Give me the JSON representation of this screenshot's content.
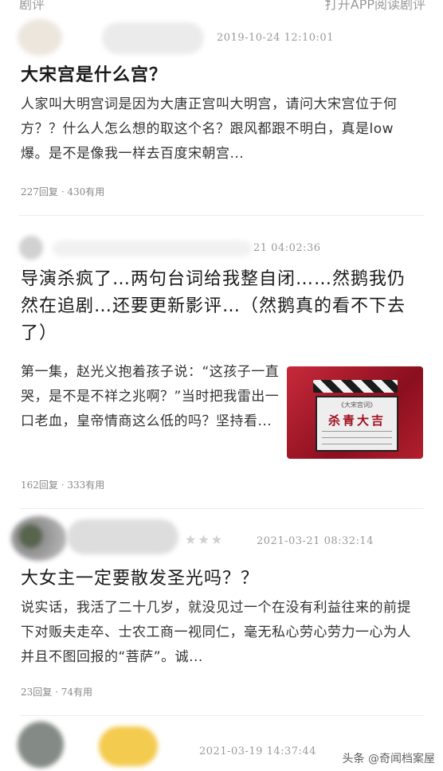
{
  "topbar": {
    "left_text": "剧评",
    "right_text": "打开APP阅读剧评"
  },
  "reviews": [
    {
      "date": "2019-10-24 12:10:01",
      "title": "大宋宫是什么宫？",
      "body": "人家叫大明宫词是因为大唐正宫叫大明宫，请问大宋宫位于何方？？什么人怎么想的取这个名？跟风都跟不明白，真是low爆。是不是像我一样去百度宋朝宫...",
      "stats": "227回复 · 430有用"
    },
    {
      "date": "21 04:02:36",
      "title": "导演杀疯了…两句台词给我整自闭……然鹅我仍然在追剧…还要更新影评…（然鹅真的看不下去了）",
      "body": "第一集，赵光义抱着孩子说：“这孩子一直哭，是不是不祥之兆啊？”当时把我雷出一口老血，皇帝情商这么低的吗？坚持看...",
      "stats": "162回复 · 333有用",
      "thumb_text": "杀青大吉",
      "thumb_sub": "《大宋宫词》"
    },
    {
      "date": "2021-03-21 08:32:14",
      "stars": "★★★",
      "title": "大女主一定要散发圣光吗？？",
      "body": "说实话，我活了二十几岁，就没见过一个在没有利益往来的前提下对贩夫走卒、士农工商一视同仁，毫无私心劳心劳力一心为人并且不图回报的“菩萨”。诚...",
      "stats": "23回复 · 74有用"
    },
    {
      "date": "2021-03-19 14:37:44"
    }
  ],
  "watermark": {
    "prefix": "头条",
    "handle": "@奇闻档案屋"
  }
}
